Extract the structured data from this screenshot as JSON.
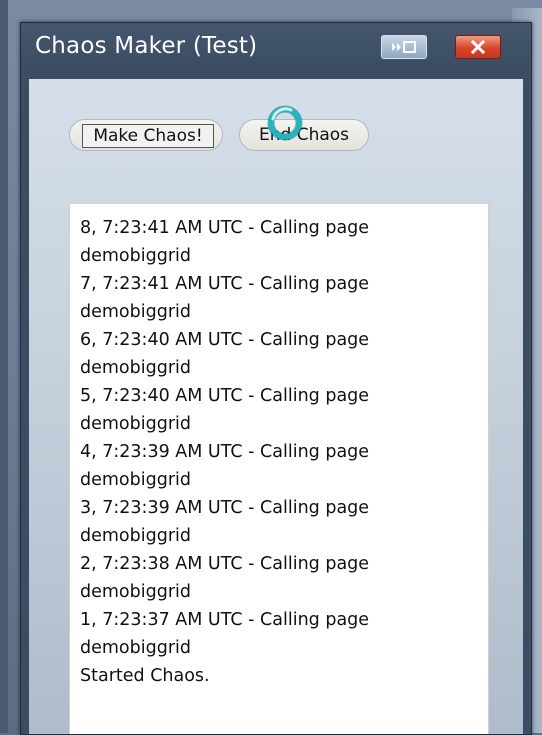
{
  "window": {
    "title": "Chaos Maker (Test)"
  },
  "buttons": {
    "make_chaos": "Make Chaos!",
    "end_chaos": "End Chaos"
  },
  "icons": {
    "pin": "pin-to-desktop-icon",
    "close": "close-icon",
    "loading": "loading-spinner-icon"
  },
  "colors": {
    "close_button": "#d9452a",
    "titlebar": "#3a4c62",
    "spinner": "#1fb5c3"
  },
  "log": {
    "lines": [
      "8, 7:23:41 AM UTC - Calling page",
      "demobiggrid",
      "7, 7:23:41 AM UTC - Calling page",
      "demobiggrid",
      "6, 7:23:40 AM UTC - Calling page",
      "demobiggrid",
      "5, 7:23:40 AM UTC - Calling page",
      "demobiggrid",
      "4, 7:23:39 AM UTC - Calling page",
      "demobiggrid",
      "3, 7:23:39 AM UTC - Calling page",
      "demobiggrid",
      "2, 7:23:38 AM UTC - Calling page",
      "demobiggrid",
      "1, 7:23:37 AM UTC - Calling page",
      "demobiggrid",
      "Started Chaos."
    ]
  }
}
